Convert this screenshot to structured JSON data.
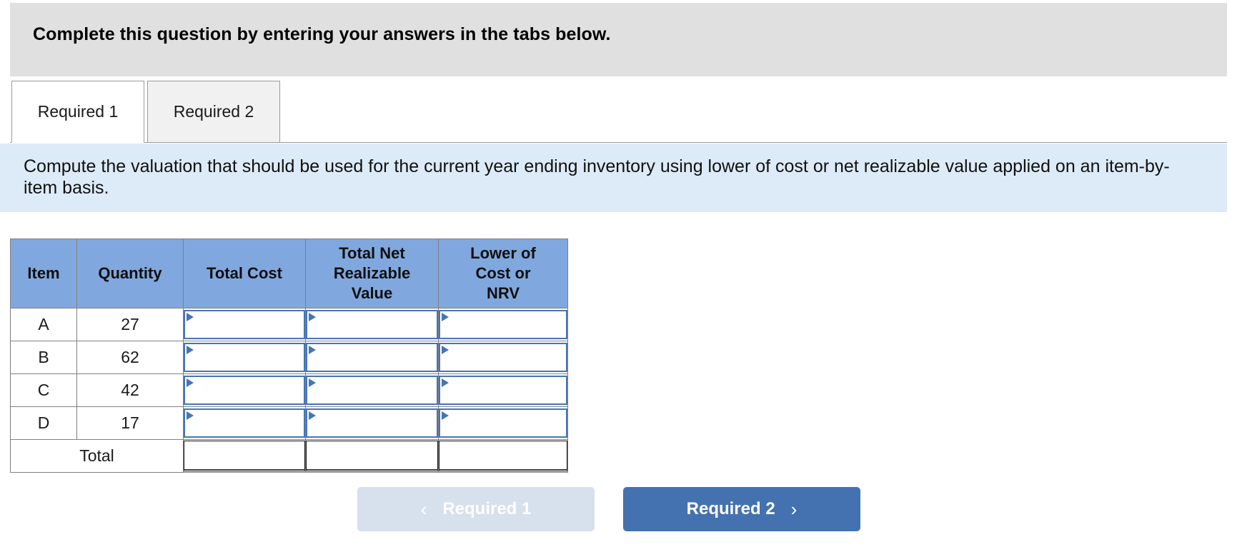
{
  "header": {
    "banner_text": "Complete this question by entering your answers in the tabs below."
  },
  "tabs": [
    {
      "label": "Required 1",
      "selected": true
    },
    {
      "label": "Required 2",
      "selected": false
    }
  ],
  "instruction": {
    "text": "Compute the valuation that should be used for the current year ending inventory using lower of cost or net realizable value applied on an item-by-item basis."
  },
  "table": {
    "columns": [
      "Item",
      "Quantity",
      "Total Cost",
      "Total Net Realizable Value",
      "Lower of Cost or NRV"
    ],
    "column_lines": [
      [
        "Item"
      ],
      [
        "Quantity"
      ],
      [
        "Total Cost"
      ],
      [
        "Total Net",
        "Realizable",
        "Value"
      ],
      [
        "Lower of",
        "Cost or",
        "NRV"
      ]
    ],
    "rows": [
      {
        "item": "A",
        "quantity": "27",
        "total_cost": "",
        "total_nrv": "",
        "lower_of_cost_or_nrv": ""
      },
      {
        "item": "B",
        "quantity": "62",
        "total_cost": "",
        "total_nrv": "",
        "lower_of_cost_or_nrv": ""
      },
      {
        "item": "C",
        "quantity": "42",
        "total_cost": "",
        "total_nrv": "",
        "lower_of_cost_or_nrv": ""
      },
      {
        "item": "D",
        "quantity": "17",
        "total_cost": "",
        "total_nrv": "",
        "lower_of_cost_or_nrv": ""
      }
    ],
    "total_row": {
      "label": "Total",
      "total_cost": "",
      "total_nrv": "",
      "lower_of_cost_or_nrv": ""
    }
  },
  "footer": {
    "prev_button": {
      "label": "Required 1",
      "icon": "chevron-left-icon",
      "glyph": "‹",
      "disabled": true
    },
    "next_button": {
      "label": "Required 2",
      "icon": "chevron-right-icon",
      "glyph": "›",
      "disabled": false
    }
  },
  "colors": {
    "top_banner_bg": "#e0e0e0",
    "instruction_bg": "#dcebf7",
    "table_header_bg": "#80a8de",
    "input_border": "#4575b4",
    "next_button_bg": "#4472b0",
    "prev_button_bg": "#d7e0ed",
    "grid_line": "#808080"
  }
}
